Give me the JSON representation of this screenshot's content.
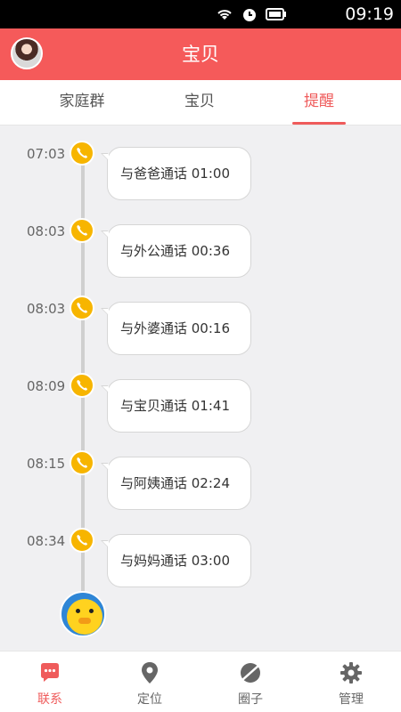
{
  "status_bar": {
    "time": "09:19"
  },
  "header": {
    "title": "宝贝"
  },
  "tabs": [
    {
      "label": "家庭群",
      "active": false
    },
    {
      "label": "宝贝",
      "active": false
    },
    {
      "label": "提醒",
      "active": true
    }
  ],
  "timeline": {
    "events": [
      {
        "time": "07:03",
        "text": "与爸爸通话  01:00",
        "icon": "phone-icon"
      },
      {
        "time": "08:03",
        "text": "与外公通话  00:36",
        "icon": "phone-icon"
      },
      {
        "time": "08:03",
        "text": "与外婆通话  00:16",
        "icon": "phone-icon"
      },
      {
        "time": "08:09",
        "text": "与宝贝通话  01:41",
        "icon": "phone-icon"
      },
      {
        "time": "08:15",
        "text": "与阿姨通话  02:24",
        "icon": "phone-icon"
      },
      {
        "time": "08:34",
        "text": "与妈妈通话  03:00",
        "icon": "phone-icon"
      }
    ]
  },
  "bottom_nav": [
    {
      "label": "联系",
      "icon": "chat-icon",
      "active": true
    },
    {
      "label": "定位",
      "icon": "location-pin-icon",
      "active": false
    },
    {
      "label": "圈子",
      "icon": "planet-icon",
      "active": false
    },
    {
      "label": "管理",
      "icon": "gear-icon",
      "active": false
    }
  ],
  "colors": {
    "accent": "#f55a5a",
    "call_icon": "#f7b500"
  }
}
